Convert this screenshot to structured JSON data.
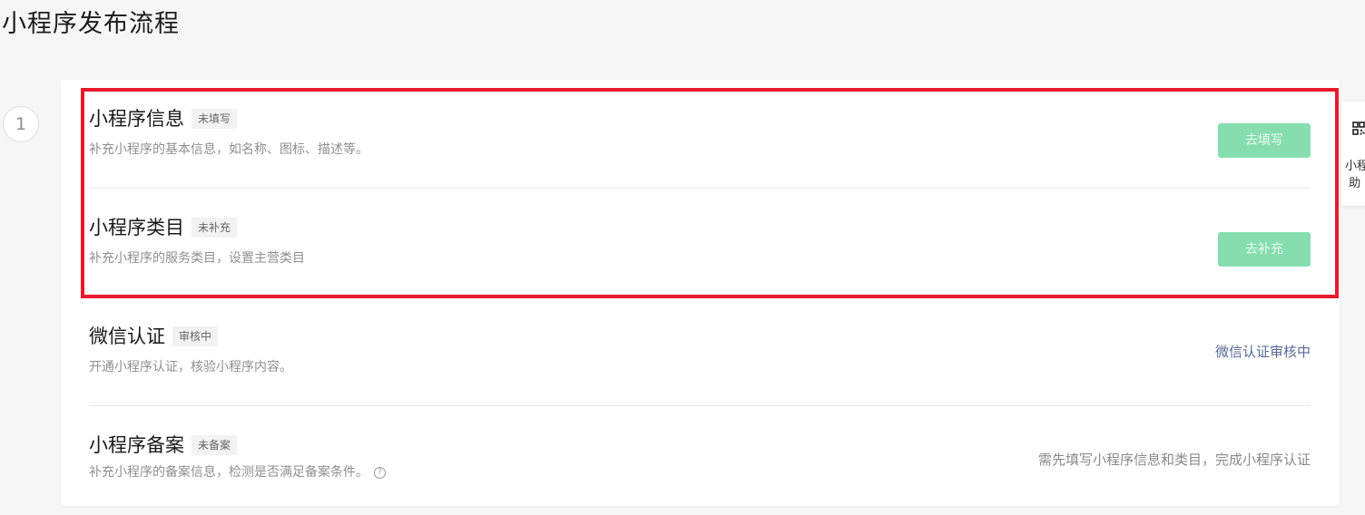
{
  "page_title": "小程序发布流程",
  "step_number": "1",
  "rows": [
    {
      "name": "小程序信息",
      "badge": "未填写",
      "desc": "补充小程序的基本信息，如名称、图标、描述等。",
      "action": "去填写"
    },
    {
      "name": "小程序类目",
      "badge": "未补充",
      "desc": "补充小程序的服务类目，设置主营类目",
      "action": "去补充"
    },
    {
      "name": "微信认证",
      "badge": "审核中",
      "desc": "开通小程序认证，核验小程序内容。",
      "status": "微信认证审核中"
    },
    {
      "name": "小程序备案",
      "badge": "未备案",
      "desc": "补充小程序的备案信息，检测是否满足备案条件。",
      "status": "需先填写小程序信息和类目，完成小程序认证"
    }
  ],
  "helper": {
    "label_line1": "小程",
    "label_line2": "助"
  },
  "colors": {
    "highlight": "#e8192c",
    "button_green": "#86deaf",
    "link_blue": "#576b95"
  },
  "icons": {
    "help": "question-circle-icon",
    "qr": "qr-code-icon"
  }
}
